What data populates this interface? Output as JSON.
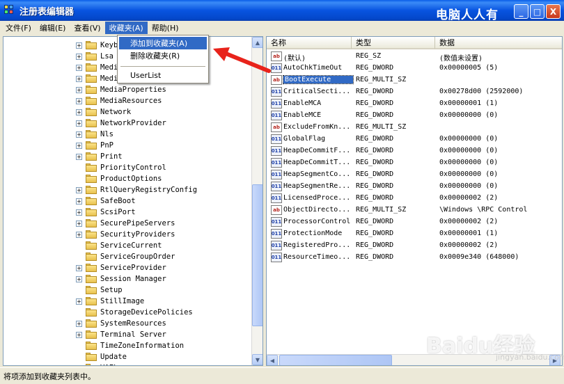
{
  "window": {
    "title": "注册表编辑器",
    "watermark": "电脑人人有",
    "controls": {
      "minimize": "_",
      "maximize": "□",
      "close": "X"
    }
  },
  "menubar": {
    "items": [
      {
        "label": "文件(F)"
      },
      {
        "label": "编辑(E)"
      },
      {
        "label": "查看(V)"
      },
      {
        "label": "收藏夹(A)"
      },
      {
        "label": "帮助(H)"
      }
    ]
  },
  "favorites_menu": {
    "items": [
      {
        "label": "添加到收藏夹(A)"
      },
      {
        "label": "删除收藏夹(R)"
      },
      {
        "label": "UserList"
      }
    ]
  },
  "tree": {
    "items": [
      {
        "label": "Keyb",
        "expandable": true
      },
      {
        "label": "Lsa",
        "expandable": true
      },
      {
        "label": "Medi",
        "expandable": true
      },
      {
        "label": "Medi",
        "expandable": true
      },
      {
        "label": "MediaProperties",
        "expandable": true
      },
      {
        "label": "MediaResources",
        "expandable": true
      },
      {
        "label": "Network",
        "expandable": true
      },
      {
        "label": "NetworkProvider",
        "expandable": true
      },
      {
        "label": "Nls",
        "expandable": true
      },
      {
        "label": "PnP",
        "expandable": true
      },
      {
        "label": "Print",
        "expandable": true
      },
      {
        "label": "PriorityControl",
        "expandable": false
      },
      {
        "label": "ProductOptions",
        "expandable": false
      },
      {
        "label": "RtlQueryRegistryConfig",
        "expandable": true
      },
      {
        "label": "SafeBoot",
        "expandable": true
      },
      {
        "label": "ScsiPort",
        "expandable": true
      },
      {
        "label": "SecurePipeServers",
        "expandable": true
      },
      {
        "label": "SecurityProviders",
        "expandable": true
      },
      {
        "label": "ServiceCurrent",
        "expandable": false
      },
      {
        "label": "ServiceGroupOrder",
        "expandable": false
      },
      {
        "label": "ServiceProvider",
        "expandable": true
      },
      {
        "label": "Session Manager",
        "expandable": true
      },
      {
        "label": "Setup",
        "expandable": false
      },
      {
        "label": "StillImage",
        "expandable": true
      },
      {
        "label": "StorageDevicePolicies",
        "expandable": false
      },
      {
        "label": "SystemResources",
        "expandable": true
      },
      {
        "label": "Terminal Server",
        "expandable": true
      },
      {
        "label": "TimeZoneInformation",
        "expandable": false
      },
      {
        "label": "Update",
        "expandable": false
      },
      {
        "label": "VAFL",
        "expandable": true
      }
    ]
  },
  "values": {
    "headers": {
      "name": "名称",
      "type": "类型",
      "data": "数据"
    },
    "rows": [
      {
        "icon": "ab",
        "name": "(默认)",
        "type": "REG_SZ",
        "data": "(数值未设置)"
      },
      {
        "icon": "dw",
        "name": "AutoChkTimeOut",
        "type": "REG_DWORD",
        "data": "0x00000005 (5)"
      },
      {
        "icon": "ab",
        "name": "BootExecute",
        "type": "REG_MULTI_SZ",
        "data": ""
      },
      {
        "icon": "dw",
        "name": "CriticalSecti...",
        "type": "REG_DWORD",
        "data": "0x00278d00 (2592000)"
      },
      {
        "icon": "dw",
        "name": "EnableMCA",
        "type": "REG_DWORD",
        "data": "0x00000001 (1)"
      },
      {
        "icon": "dw",
        "name": "EnableMCE",
        "type": "REG_DWORD",
        "data": "0x00000000 (0)"
      },
      {
        "icon": "ab",
        "name": "ExcludeFromKn...",
        "type": "REG_MULTI_SZ",
        "data": ""
      },
      {
        "icon": "dw",
        "name": "GlobalFlag",
        "type": "REG_DWORD",
        "data": "0x00000000 (0)"
      },
      {
        "icon": "dw",
        "name": "HeapDeCommitF...",
        "type": "REG_DWORD",
        "data": "0x00000000 (0)"
      },
      {
        "icon": "dw",
        "name": "HeapDeCommitT...",
        "type": "REG_DWORD",
        "data": "0x00000000 (0)"
      },
      {
        "icon": "dw",
        "name": "HeapSegmentCo...",
        "type": "REG_DWORD",
        "data": "0x00000000 (0)"
      },
      {
        "icon": "dw",
        "name": "HeapSegmentRe...",
        "type": "REG_DWORD",
        "data": "0x00000000 (0)"
      },
      {
        "icon": "dw",
        "name": "LicensedProce...",
        "type": "REG_DWORD",
        "data": "0x00000002 (2)"
      },
      {
        "icon": "ab",
        "name": "ObjectDirecto...",
        "type": "REG_MULTI_SZ",
        "data": "\\Windows \\RPC Control"
      },
      {
        "icon": "dw",
        "name": "ProcessorControl",
        "type": "REG_DWORD",
        "data": "0x00000002 (2)"
      },
      {
        "icon": "dw",
        "name": "ProtectionMode",
        "type": "REG_DWORD",
        "data": "0x00000001 (1)"
      },
      {
        "icon": "dw",
        "name": "RegisteredPro...",
        "type": "REG_DWORD",
        "data": "0x00000002 (2)"
      },
      {
        "icon": "dw",
        "name": "ResourceTimeo...",
        "type": "REG_DWORD",
        "data": "0x0009e340 (648000)"
      }
    ]
  },
  "statusbar": {
    "text": "将项添加到收藏夹列表中。"
  },
  "overlay": {
    "brand": "Baidu经验",
    "domain": "jingyan.baidu.com"
  },
  "colors": {
    "titlebar": "#0854e0",
    "highlight": "#316ac5",
    "arrow": "#e8231b"
  }
}
